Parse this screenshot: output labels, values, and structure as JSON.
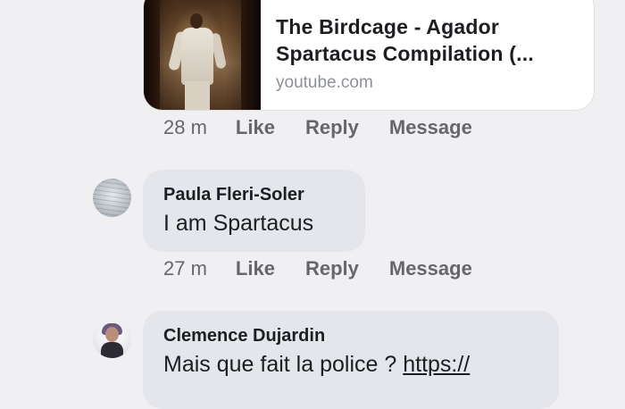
{
  "link_preview": {
    "title_line1": "The Birdcage - Agador",
    "title_line2": "Spartacus Compilation (...",
    "domain": "youtube.com"
  },
  "first_meta": {
    "time": "28 m",
    "like": "Like",
    "reply": "Reply",
    "message": "Message"
  },
  "comments": [
    {
      "author": "Paula Fleri-Soler",
      "text": "I am Spartacus",
      "time": "27 m",
      "like": "Like",
      "reply": "Reply",
      "message": "Message"
    },
    {
      "author": "Clemence Dujardin",
      "text": "Mais que fait la police ?",
      "link_text": "https://"
    }
  ]
}
